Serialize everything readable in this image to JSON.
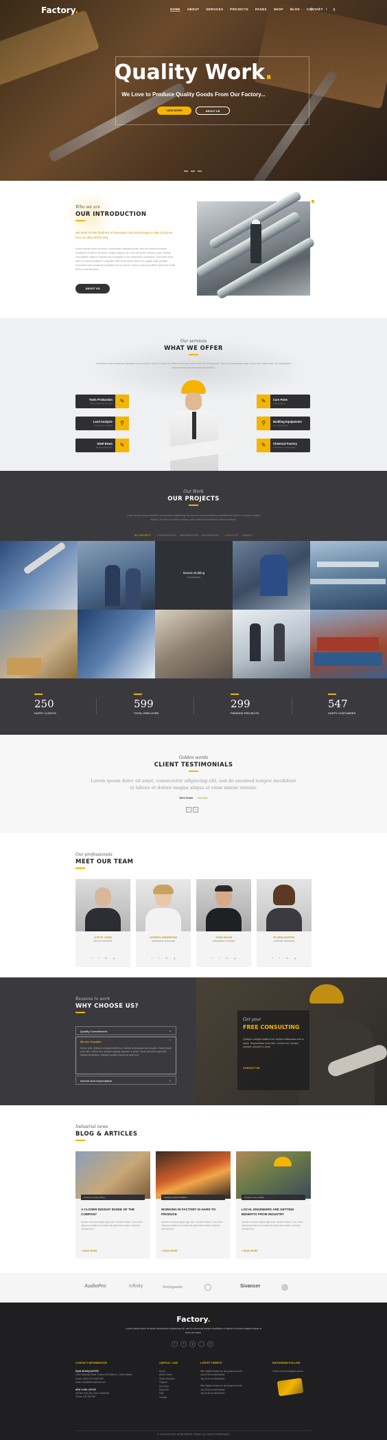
{
  "header": {
    "logo": "Factory",
    "nav": [
      "HOME",
      "ABOUT",
      "SERVICES",
      "PROJECTS",
      "PAGES",
      "SHOP",
      "BLOG",
      "CONTACT"
    ]
  },
  "hero": {
    "title": "Quality Work",
    "subtitle": "We Love to Produce Quality Goods From Our Factory...",
    "primary_button": "VIEW MORE",
    "secondary_button": "ABOUT US"
  },
  "intro": {
    "kicker": "Who we are",
    "title": "OUR INTRODUCTION",
    "lead": "We work on the forefront of innovation and technology to take products from an idea all the way.",
    "body": "Lorem ipsum dolor sit amet, consectetur adipiscing elit, sed do eiusmod tempor incididunt ut labore et dolore magna aliqua. Ut enim ad minim veniam, quis nostrud exercitation ullamco laboris nisi ut aliquip ex ea commodo consequat. Duis aute irure dolor in reprehenderit in voluptate velit esse cillum dolore eu fugiat nulla pariatur. Excepteur sint occaecat cupidatat non proident, sunt in culpa qui officia deserunt mollit anim id est laborum.",
    "button": "ABOUT US"
  },
  "services": {
    "kicker": "Our services",
    "title": "WHAT WE OFFER",
    "intro": "Excepteur sint occaecat cupidatat non proident, sunt in culpa qui officia deserunt mollit anim id est laborum. Sed ut perspiciatis unde omnis iste natus error sit voluptatem accusantium doloremque laudantium.",
    "left": [
      {
        "title": "Tools Production",
        "sub": "Pliers, wrenches & more"
      },
      {
        "title": "Land Analysis",
        "sub": "Computer's analysis"
      },
      {
        "title": "Steel Beam",
        "sub": "Metal construction"
      }
    ],
    "right": [
      {
        "title": "Cars Parts",
        "sub": "Auto industry"
      },
      {
        "title": "Building Equipments",
        "sub": "For construction"
      },
      {
        "title": "Chemical Factory",
        "sub": "Production of chemicals"
      }
    ]
  },
  "projects": {
    "kicker": "Our Work",
    "title": "OUR PROJECTS",
    "intro": "Lorem ipsum dolor sit amet, consectetur adipiscing elit, sed do eiusmod tempor incididunt ut labore et dolore magna aliqua. Ut enim ad minim veniam, quis nostrud exercitation ullamco laboris.",
    "filters": [
      "ALL PROJECT",
      "CONSTRUCTION",
      "MANUFACTURE",
      "ENGINEERING",
      "LOGISTICS",
      "ENERGY"
    ],
    "hover_label": "Mosaic Building",
    "hover_sub": "Construction"
  },
  "counters": [
    {
      "num": "250",
      "label": "HAPPY CLIENTS"
    },
    {
      "num": "599",
      "label": "TOTAL EMPLOYEE"
    },
    {
      "num": "299",
      "label": "FINISHED PROJECTS"
    },
    {
      "num": "547",
      "label": "HAPPY CUSTOMERS"
    }
  ],
  "testimonials": {
    "kicker": "Golden words",
    "title": "CLIENT TESTIMONIALS",
    "quote": "Lorem ipsum dolor sit amet, consectetur adipiscing elit, sed do eiusmod tempor incididunt ut labore et dolore magna aliqua ut enim minim veniam.",
    "author": "John Snow",
    "author_role": "Manager"
  },
  "team": {
    "kicker": "Our professionals",
    "title": "MEET OUR TEAM",
    "members": [
      {
        "name": "STEVE JOHN",
        "role": "CEO OF INDUSTRY"
      },
      {
        "name": "JOSEPH ANDERSON",
        "role": "MARKETING MANAGER"
      },
      {
        "name": "JOHN SNOW",
        "role": "PRESIDENT FOUNDER"
      },
      {
        "name": "ELVIRA MARTIN",
        "role": "SUPPORT MANAGER"
      }
    ]
  },
  "why": {
    "kicker": "Reasons to work",
    "title": "WHY CHOOSE US?",
    "accordion": [
      {
        "title": "Quality Commitment",
        "open": false
      },
      {
        "title": "We Are Creative",
        "open": true,
        "body": "Donec odio. Quisque volutpat mattis eros. Nullam malesuada erat ut turpis. Suspendisse urna nibh, viverra non, semper suscipit, posuere a, pede. Donec nec justo eget felis facilisis fermentum. Aliquam porttitor mauris sit amet orci."
      },
      {
        "title": "Honest And Dependable",
        "open": false
      }
    ],
    "consult_kicker": "Get your",
    "consult_title": "FREE CONSULTING",
    "consult_body": "Quisque volutpat mattis eros. Nullam malesuada erat ut turpis. Suspendisse urna nibh, viverra non, semper suscipit, posuere a, pede.",
    "consult_link": "CONTACT US"
  },
  "blog": {
    "kicker": "Industrial news",
    "title": "BLOG & ARTICLES",
    "posts": [
      {
        "meta": "Posted by George Wilson",
        "title": "A CLOSER INSIGHT INSIDE OF THE COMPANY",
        "excerpt": "Aenean commodo ligula eget dolor. Aenean massa. Cum sociis natoque penatibus et magnis dis parturient montes, nascetur ridiculus mus.",
        "more": "READ MORE"
      },
      {
        "meta": "Posted by Andrew Williams",
        "title": "WORKING IN FACTORY IS HARD TO PRODUCE",
        "excerpt": "Aenean commodo ligula eget dolor. Aenean massa. Cum sociis natoque penatibus et magnis dis parturient montes, nascetur ridiculus mus.",
        "more": "READ MORE"
      },
      {
        "meta": "Posted by Sonny Black",
        "title": "LOCAL ENGINEERS ARE GETTING BENEFITS FROM INDUSTRY",
        "excerpt": "Aenean commodo ligula eget dolor. Aenean massa. Cum sociis natoque penatibus et magnis dis parturient montes, nascetur ridiculus mus.",
        "more": "READ MORE"
      }
    ]
  },
  "partners": [
    "AudioPro",
    "Infinity",
    "Stromgaarde",
    "Sivanser"
  ],
  "footer": {
    "logo": "Factory",
    "about": "Lorem ipsum dolor sit amet consectetur adipiscing elit, sed do eiusmod tempor incididunt ut labore et dolore magna aliqua ut enim ad minim.",
    "col1_title": "CONTACT INFORMATION",
    "col1_lines": [
      "MAIN HEADQUARTER",
      "1234 Industrial Street, Factory 500 Millions - United States",
      "Phone: (800) 0123 4567 890",
      "Email: hello@factorytheme.net",
      "",
      "NEW YORK OFFICE",
      "45 New York City Lines Centerfield",
      "Phone: 123 456 789"
    ],
    "col2_title": "USEFULL LINK",
    "col2_lines": [
      "Home",
      "About Theme",
      "Online Services",
      "Projects",
      "Our Shop",
      "Blog Area",
      "FAQ",
      "Contact"
    ],
    "col3_title": "LATEST TWEETS",
    "col3_lines": [
      "After digital industry we are going to launch",
      "July 2016 via Webmaster",
      "July 2016 via Webmaster",
      "",
      "After digital industry we are going to launch",
      "July 2016 via Webmaster",
      "July 2016 via Webmaster"
    ],
    "col4_title": "INSTAGRAM FOLLOW",
    "col4_text": "Follow us from Instagram photo",
    "copyright": "© 2016 FACTORY WORDPRESS THEME. ALL RIGHTS RESERVED."
  }
}
